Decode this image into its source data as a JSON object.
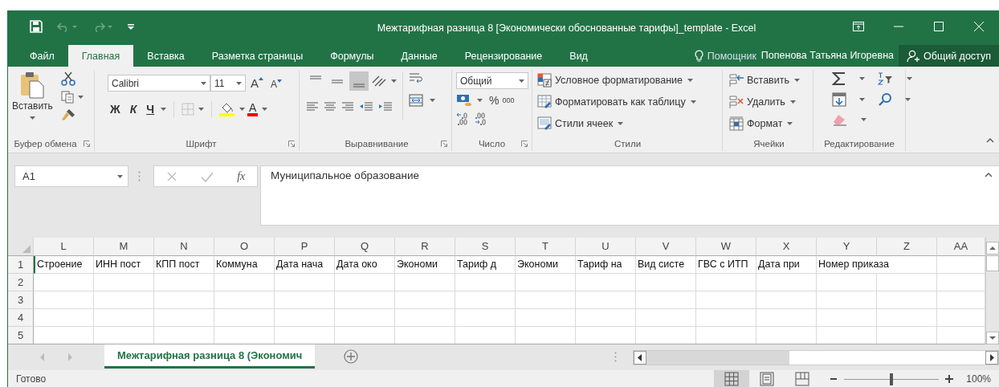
{
  "window": {
    "title": "Межтарифная разница 8 [Экономически обоснованные тарифы]_template - Excel"
  },
  "ribbon_tabs": [
    {
      "label": "Файл",
      "selected": false
    },
    {
      "label": "Главная",
      "selected": true
    },
    {
      "label": "Вставка",
      "selected": false
    },
    {
      "label": "Разметка страницы",
      "selected": false
    },
    {
      "label": "Формулы",
      "selected": false
    },
    {
      "label": "Данные",
      "selected": false
    },
    {
      "label": "Рецензирование",
      "selected": false
    },
    {
      "label": "Вид",
      "selected": false
    }
  ],
  "tell_me": "Помощник",
  "user": "Попенова Татьяна Игоревна",
  "share": "Общий доступ",
  "clipboard": {
    "paste": "Вставить",
    "label": "Буфер обмена"
  },
  "font": {
    "name": "Calibri",
    "size": "11",
    "grow": "A",
    "shrink": "A",
    "bold": "Ж",
    "italic": "К",
    "underline": "Ч",
    "font_color": "A",
    "label": "Шрифт"
  },
  "alignment": {
    "vertical": [
      {
        "selected": false
      },
      {
        "selected": false
      },
      {
        "selected": true
      }
    ],
    "label": "Выравнивание"
  },
  "number": {
    "format": "Общий",
    "percent": "%",
    "thousands": "000",
    "label": "Число"
  },
  "styles": {
    "items": [
      "Условное форматирование",
      "Форматировать как таблицу",
      "Стили ячеек"
    ],
    "label": "Стили"
  },
  "cells": {
    "items": [
      "Вставить",
      "Удалить",
      "Формат"
    ],
    "label": "Ячейки"
  },
  "editing": {
    "label": "Редактирование"
  },
  "name_box": "A1",
  "function_label": "fx",
  "formula": "Муниципальное образование",
  "sheet": {
    "columns": [
      "L",
      "M",
      "N",
      "O",
      "P",
      "Q",
      "R",
      "S",
      "T",
      "U",
      "V",
      "W",
      "X",
      "Y",
      "Z",
      "AA"
    ],
    "rows": [
      {
        "number": "1",
        "cells": [
          "Строение",
          "ИНН пост",
          "КПП пост",
          "Коммуна",
          "Дата нача",
          "Дата око",
          "Экономи",
          "Тариф д",
          "Экономи",
          "Тариф на",
          "Вид систе",
          "ГВС с ИТП",
          "Дата при",
          "Номер приказа"
        ]
      },
      {
        "number": "2"
      },
      {
        "number": "3"
      },
      {
        "number": "4"
      },
      {
        "number": "5"
      }
    ]
  },
  "sheet_tabs": [
    {
      "label": "Межтарифная разница 8 (Экономич",
      "selected": true
    }
  ],
  "status_bar": {
    "text": "Готово",
    "views": [
      {
        "selected": true
      },
      {
        "selected": false
      },
      {
        "selected": false
      }
    ],
    "zoom": {
      "level": 0.5,
      "reading": "100%"
    }
  }
}
